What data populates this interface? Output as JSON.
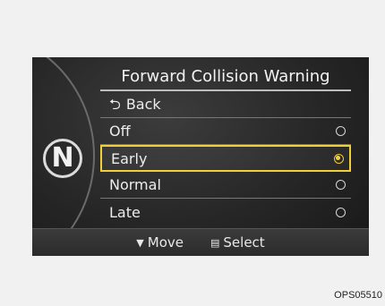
{
  "gear": "N",
  "menu": {
    "title": "Forward Collision Warning",
    "back_label": "Back",
    "options": [
      {
        "label": "Off",
        "checked": false
      },
      {
        "label": "Early",
        "checked": true
      },
      {
        "label": "Normal",
        "checked": false
      },
      {
        "label": "Late",
        "checked": false
      }
    ]
  },
  "footer": {
    "move_label": "Move",
    "select_label": "Select"
  },
  "figure_code": "OPS05510",
  "colors": {
    "accent": "#f1cf3b",
    "panel": "#262626",
    "text": "#ececec"
  },
  "icons": {
    "back": "return-arrow-icon",
    "move": "down-triangle-icon",
    "select": "steering-wheel-button-icon"
  }
}
